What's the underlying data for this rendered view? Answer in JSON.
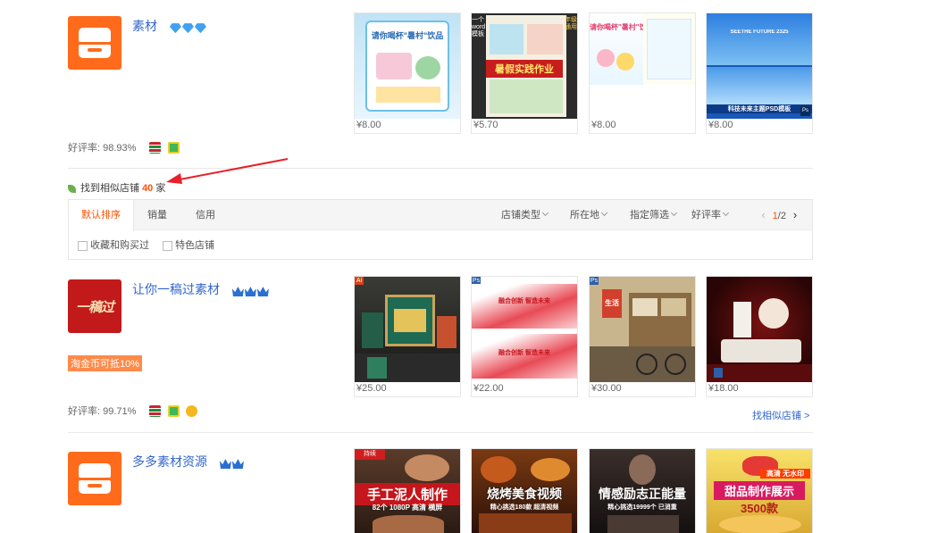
{
  "shops": [
    {
      "name": "素材",
      "badges": [
        "diamond-icon",
        "diamond-icon",
        "diamond-icon"
      ],
      "rating_label": "好评率: 98.93%",
      "prices": [
        "¥8.00",
        "¥5.70",
        "¥8.00",
        "¥8.00"
      ]
    },
    {
      "name": "让你一稿过素材",
      "logo_text": "一稿过",
      "badges": [
        "crown-icon",
        "crown-icon",
        "crown-icon"
      ],
      "coupon": "淘金币可抵10%",
      "rating_label": "好评率: 99.71%",
      "prices": [
        "¥25.00",
        "¥22.00",
        "¥30.00",
        "¥18.00"
      ],
      "find_similar": "找相似店铺 >"
    },
    {
      "name": "多多素材资源",
      "badges": [
        "crown-icon",
        "crown-icon"
      ]
    }
  ],
  "found": {
    "prefix": "找到相似店铺",
    "count": "40",
    "suffix": "家"
  },
  "sort_tabs": [
    "默认排序",
    "销量",
    "信用"
  ],
  "dropdowns": [
    "店铺类型",
    "所在地",
    "指定筛选",
    "好评率"
  ],
  "pager": {
    "prev": "‹",
    "current": "1",
    "sep": "/",
    "total": "2",
    "next": "›"
  },
  "checkboxes": [
    "收藏和购买过",
    "特色店铺"
  ],
  "thumb_text": {
    "s1_1": "请你喝杯\"暑村\"饮品",
    "s1_2a": "暑假实践作业",
    "s1_2b": "一个word模板",
    "s1_2c": "年级通用",
    "s1_3": "请你喝杯\"暑村\"饮品",
    "s1_4a": "SEETHE FUTURE 2325",
    "s1_4b": "科技未来主题PSD模板",
    "s2_2": "融合创新 智造未来",
    "s2_3": "生活",
    "s3_1a": "手工泥人制作",
    "s3_1b": "82个 1080P 高清 横屏",
    "s3_2a": "烧烤美食视频",
    "s3_2b": "精心挑选180款 超清视频",
    "s3_3a": "情感励志正能量",
    "s3_3b": "精心挑选19999个 已消重",
    "s3_4a": "甜品制作展示",
    "s3_4b": "3500款",
    "s3_4c": "高清 无水印"
  },
  "colors": {
    "accent": "#ff5000",
    "link": "#3366cc",
    "shop_orange": "#ff6b1a",
    "arrow_red": "#e8202a"
  }
}
